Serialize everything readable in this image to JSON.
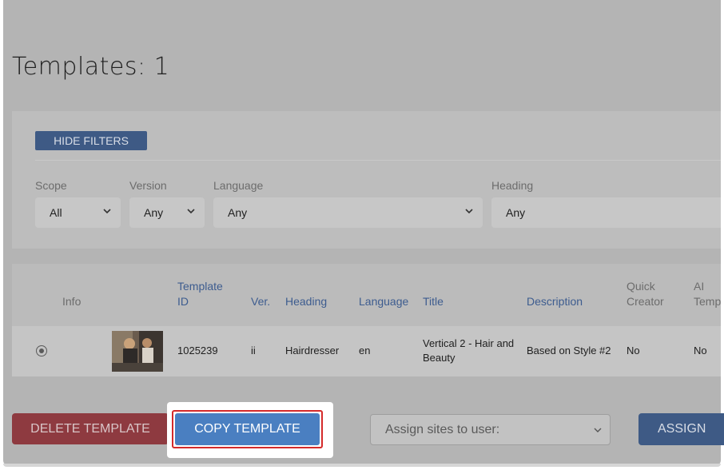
{
  "page": {
    "title": "Templates: 1"
  },
  "filters": {
    "hide_label": "HIDE FILTERS",
    "scope": {
      "label": "Scope",
      "value": "All"
    },
    "version": {
      "label": "Version",
      "value": "Any"
    },
    "language": {
      "label": "Language",
      "value": "Any"
    },
    "heading": {
      "label": "Heading",
      "value": "Any"
    }
  },
  "table": {
    "headers": {
      "info": "Info",
      "template_id_1": "Template",
      "template_id_2": "ID",
      "ver": "Ver.",
      "heading": "Heading",
      "language": "Language",
      "title": "Title",
      "description": "Description",
      "quick_creator_1": "Quick",
      "quick_creator_2": "Creator",
      "ai_1": "AI",
      "ai_2": "Templ"
    },
    "rows": [
      {
        "template_id": "1025239",
        "ver": "ii",
        "heading": "Hairdresser",
        "language": "en",
        "title_1": "Vertical 2 - Hair and",
        "title_2": "Beauty",
        "description": "Based on Style #2",
        "quick_creator": "No",
        "ai": "No"
      }
    ]
  },
  "actions": {
    "delete_label": "DELETE TEMPLATE",
    "copy_label": "COPY TEMPLATE",
    "assign_placeholder": "Assign sites to user:",
    "assign_label": "ASSIGN"
  },
  "colors": {
    "primary": "#4a7fc1",
    "danger": "#8e3a40",
    "highlight_outline": "#d42a2a"
  }
}
